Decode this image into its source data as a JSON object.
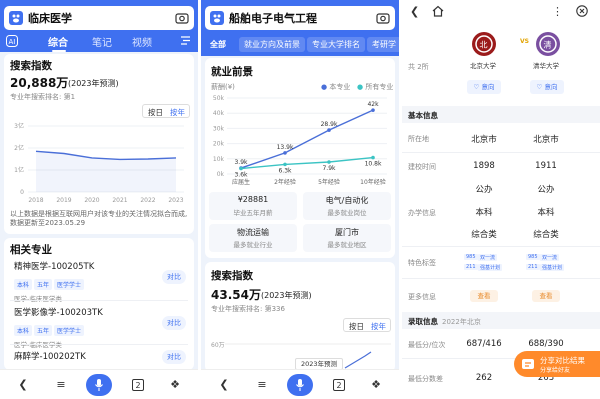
{
  "left": {
    "query": "临床医学",
    "tabs": [
      "综合",
      "笔记",
      "视频"
    ],
    "search_index": {
      "title": "搜索指数",
      "value": "20,888万",
      "value_note": "(2023年预测)",
      "rank": "专业年搜索排名: 第1",
      "toggle": [
        "按日",
        "按年"
      ],
      "y_ticks": [
        "3亿",
        "2亿",
        "1亿",
        "0"
      ],
      "x_ticks": [
        "2018",
        "2019",
        "2020",
        "2021",
        "2022",
        "2023"
      ],
      "desc": "以上数据是根据互联网用户对该专业的关注情况拟合而成, 数据更新至2023.05.29"
    },
    "related": {
      "title": "相关专业",
      "items": [
        {
          "name": "精神医学-100205TK",
          "tags": [
            "本科",
            "五年",
            "医学学士"
          ],
          "sub": "医学-临床医学类",
          "compare": "对比"
        },
        {
          "name": "医学影像学-100203TK",
          "tags": [
            "本科",
            "五年",
            "医学学士"
          ],
          "sub": "医学-临床医学类",
          "compare": "对比"
        },
        {
          "name": "麻醉学-100202TK",
          "tags": [],
          "sub": "",
          "compare": "对比"
        }
      ]
    }
  },
  "middle": {
    "query": "船舶电子电气工程",
    "chips": [
      "全部",
      "就业方向及前景",
      "专业大学排名",
      "考研学"
    ],
    "employment": {
      "title": "就业前景",
      "ylabel": "薪酬(¥)",
      "legend": [
        "本专业",
        "所有专业"
      ],
      "cards": [
        {
          "value": "¥28881",
          "label": "毕业五年月薪"
        },
        {
          "value": "电气/自动化",
          "label": "最多就业岗位"
        },
        {
          "value": "物流运输",
          "label": "最多就业行业"
        },
        {
          "value": "厦门市",
          "label": "最多就业地区"
        }
      ]
    },
    "search_index": {
      "title": "搜索指数",
      "value": "43.54万",
      "value_note": "(2023年预测)",
      "rank": "专业年搜索排名: 第336",
      "toggle": [
        "按日",
        "按年"
      ],
      "y_tick": "60万",
      "tooltip": "2023年预测"
    }
  },
  "right": {
    "count_label": "共 2所",
    "schools": [
      {
        "name": "北京大学",
        "follow": "意向"
      },
      {
        "name": "清华大学",
        "follow": "意向"
      }
    ],
    "vs": "VS",
    "basic": {
      "title": "基本信息",
      "rows": [
        {
          "label": "所在地",
          "values": [
            "北京市",
            "北京市"
          ]
        },
        {
          "label": "建校时间",
          "values": [
            "1898",
            "1911"
          ]
        },
        {
          "label": "办学信息",
          "values": [
            [
              "公办",
              "本科",
              "综合类"
            ],
            [
              "公办",
              "本科",
              "综合类"
            ]
          ]
        },
        {
          "label": "特色标签",
          "values": [
            [
              "985",
              "211",
              "双一流",
              "强基计划"
            ],
            [
              "985",
              "211",
              "双一流",
              "强基计划"
            ]
          ]
        },
        {
          "label": "更多信息",
          "values": [
            "查看",
            "查看"
          ]
        }
      ]
    },
    "admission": {
      "title": "录取信息",
      "note": "2022年北京",
      "rows": [
        {
          "label": "最低分/位次",
          "values": [
            "687/416",
            "688/390"
          ]
        },
        {
          "label": "最低分数差",
          "values": [
            "262",
            "263"
          ]
        }
      ]
    },
    "float_button": {
      "title": "分享对比结果",
      "sub": "分享给好友"
    }
  },
  "chart_data": [
    {
      "type": "line",
      "title": "搜索指数",
      "x": [
        "2018",
        "2019",
        "2020",
        "2021",
        "2022",
        "2023"
      ],
      "series": [
        {
          "name": "",
          "values": [
            1.85,
            1.75,
            1.55,
            1.48,
            1.5,
            1.55
          ]
        }
      ],
      "yticks": [
        "0",
        "1亿",
        "2亿",
        "3亿"
      ],
      "ylim": [
        0,
        3
      ]
    },
    {
      "type": "line",
      "title": "就业前景",
      "ylabel": "薪酬(¥)",
      "categories": [
        "应届生",
        "2年经验",
        "5年经验",
        "10年经验"
      ],
      "series": [
        {
          "name": "本专业",
          "values": [
            3.9,
            13.9,
            28.9,
            42
          ]
        },
        {
          "name": "所有专业",
          "values": [
            3.6,
            6.3,
            7.9,
            10.8
          ]
        }
      ],
      "value_labels": [
        [
          "3.9k",
          "13.9k",
          "28.9k",
          "42k"
        ],
        [
          "3.6k",
          "6.3k",
          "7.9k",
          "10.8k"
        ]
      ],
      "yticks": [
        "0k",
        "10k",
        "20k",
        "30k",
        "40k",
        "50k"
      ],
      "ylim": [
        0,
        50
      ],
      "colors": [
        "#4a6fd8",
        "#3cc4c4"
      ]
    }
  ]
}
